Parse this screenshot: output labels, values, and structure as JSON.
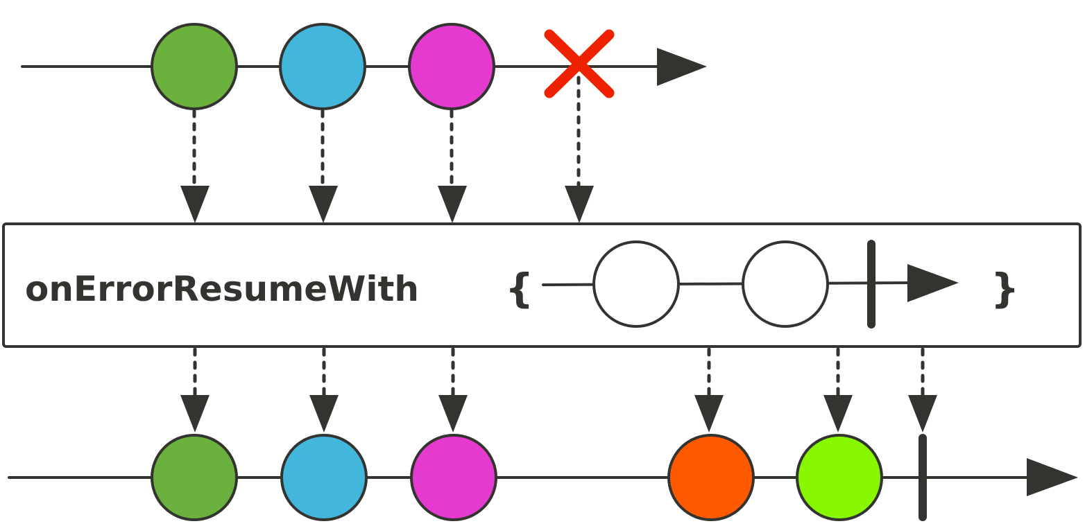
{
  "operator": {
    "name": "onErrorResumeWith",
    "open_brace": "{",
    "close_brace": "}"
  },
  "colors": {
    "stroke": "#333330",
    "green": "#6BB13E",
    "blue": "#43B6DC",
    "magenta": "#E53ACF",
    "orange": "#FF5A00",
    "lime": "#88F800",
    "error": "#EE2200",
    "hollow": "#FFFFFF"
  },
  "source_stream": {
    "items": [
      {
        "color": "green"
      },
      {
        "color": "blue"
      },
      {
        "color": "magenta"
      }
    ],
    "terminal": "error"
  },
  "fallback_stream": {
    "items": [
      {
        "color": "hollow"
      },
      {
        "color": "hollow"
      }
    ],
    "terminal": "complete"
  },
  "result_stream": {
    "items": [
      {
        "color": "green"
      },
      {
        "color": "blue"
      },
      {
        "color": "magenta"
      },
      {
        "color": "orange"
      },
      {
        "color": "lime"
      }
    ],
    "terminal": "complete"
  }
}
